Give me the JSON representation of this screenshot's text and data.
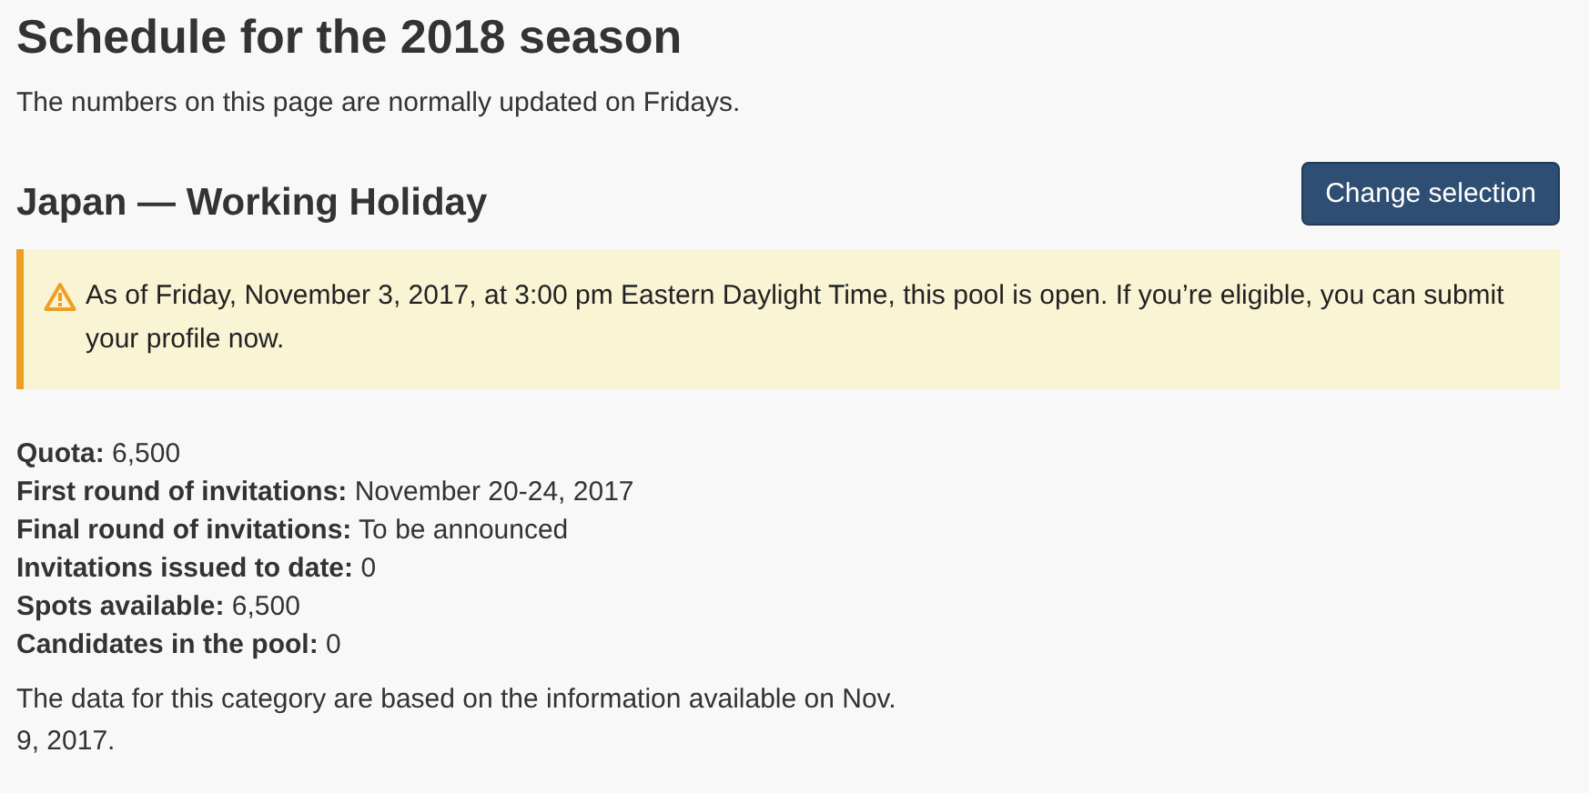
{
  "heading": "Schedule for the 2018 season",
  "intro": "The numbers on this page are normally updated on Fridays.",
  "category": {
    "title": "Japan — Working Holiday",
    "button": "Change selection"
  },
  "alert": {
    "kind": "warning",
    "text": "As of Friday, November 3, 2017, at 3:00 pm Eastern Daylight Time, this pool is open. If you’re eligible, you can submit your profile now."
  },
  "stats": [
    {
      "text": "**Quota:** 6,500"
    },
    {
      "text": "**First round of invitations:** November 20-24, 2017"
    },
    {
      "text": "**Final round of invitations:** To be announced"
    },
    {
      "text": "**Invitations issued to date:** 0"
    },
    {
      "text": "**Spots available:** 6,500"
    },
    {
      "text": "**Candidates in the pool:** 0"
    }
  ],
  "note": "The data for this category are based on the information available on Nov. 9, 2017."
}
